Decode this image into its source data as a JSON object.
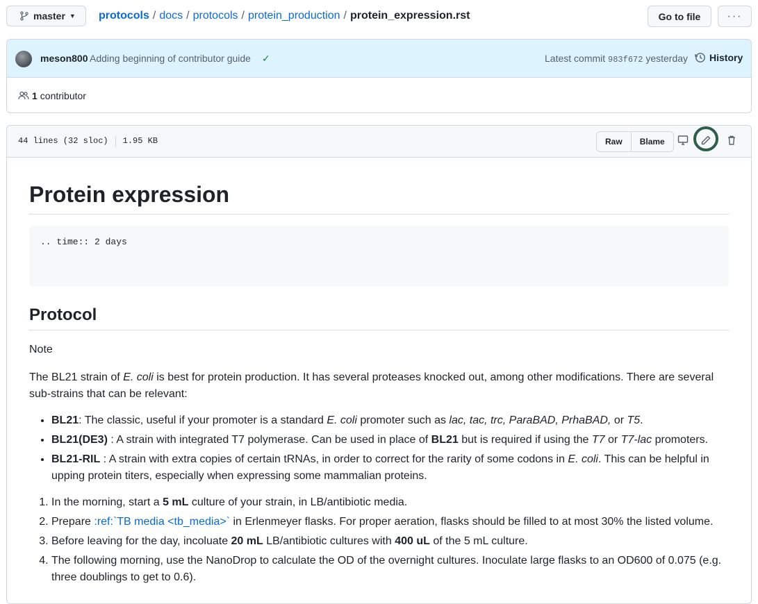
{
  "topbar": {
    "branch": "master",
    "breadcrumb": [
      "protocols",
      "docs",
      "protocols",
      "protein_production"
    ],
    "file_name": "protein_expression.rst",
    "go_to_file": "Go to file",
    "more": "···"
  },
  "commit": {
    "author": "meson800",
    "message": "Adding beginning of contributor guide",
    "latest_label": "Latest commit",
    "sha": "983f672",
    "when": "yesterday",
    "history": "History",
    "contributors_count": "1",
    "contributors_label": "contributor"
  },
  "file": {
    "lines": "44 lines (32 sloc)",
    "size": "1.95 KB",
    "raw": "Raw",
    "blame": "Blame"
  },
  "doc": {
    "title": "Protein expression",
    "code": ".. time:: 2 days",
    "h2": "Protocol",
    "note": "Note",
    "intro_1": "The BL21 strain of ",
    "intro_ecoli": "E. coli",
    "intro_2": " is best for protein production. It has several proteases knocked out, among other modifications. There are several sub-strains that can be relevant:",
    "b1_strong": "BL21",
    "b1_a": ": The classic, useful if your promoter is a standard ",
    "b1_ecoli": "E. coli",
    "b1_b": " promoter such as ",
    "b1_prom": "lac, tac, trc, ParaBAD, PrhaBAD,",
    "b1_c": " or ",
    "b1_t5": "T5",
    "b1_d": ".",
    "b2_strong": "BL21(DE3)",
    "b2_a": " : A strain with integrated T7 polymerase. Can be used in place of ",
    "b2_bl21": "BL21",
    "b2_b": " but is required if using the ",
    "b2_t7": "T7",
    "b2_c": " or ",
    "b2_t7lac": "T7-lac",
    "b2_d": " promoters.",
    "b3_strong": "BL21-RIL",
    "b3_a": " : A strain with extra copies of certain tRNAs, in order to correct for the rarity of some codons in ",
    "b3_ecoli": "E. coli",
    "b3_b": ". This can be helpful in upping protein titers, especially when expressing some mammalian proteins.",
    "s1_a": "In the morning, start a ",
    "s1_strong": "5 mL",
    "s1_b": " culture of your strain, in LB/antibiotic media.",
    "s2_a": "Prepare ",
    "s2_link": ":ref:`TB media <tb_media>`",
    "s2_b": " in Erlenmeyer flasks. For proper aeration, flasks should be filled to at most 30% the listed volume.",
    "s3_a": "Before leaving for the day, incoluate ",
    "s3_strong1": "20 mL",
    "s3_b": " LB/antibiotic cultures with ",
    "s3_strong2": "400 uL",
    "s3_c": " of the 5 mL culture.",
    "s4": "The following morning, use the NanoDrop to calculate the OD of the overnight cultures. Inoculate large flasks to an OD600 of 0.075 (e.g. three doublings to get to 0.6)."
  },
  "colors": {
    "link": "#0969da",
    "commit_bg": "#ddf4ff",
    "highlight_ring": "#2f5d4a"
  }
}
